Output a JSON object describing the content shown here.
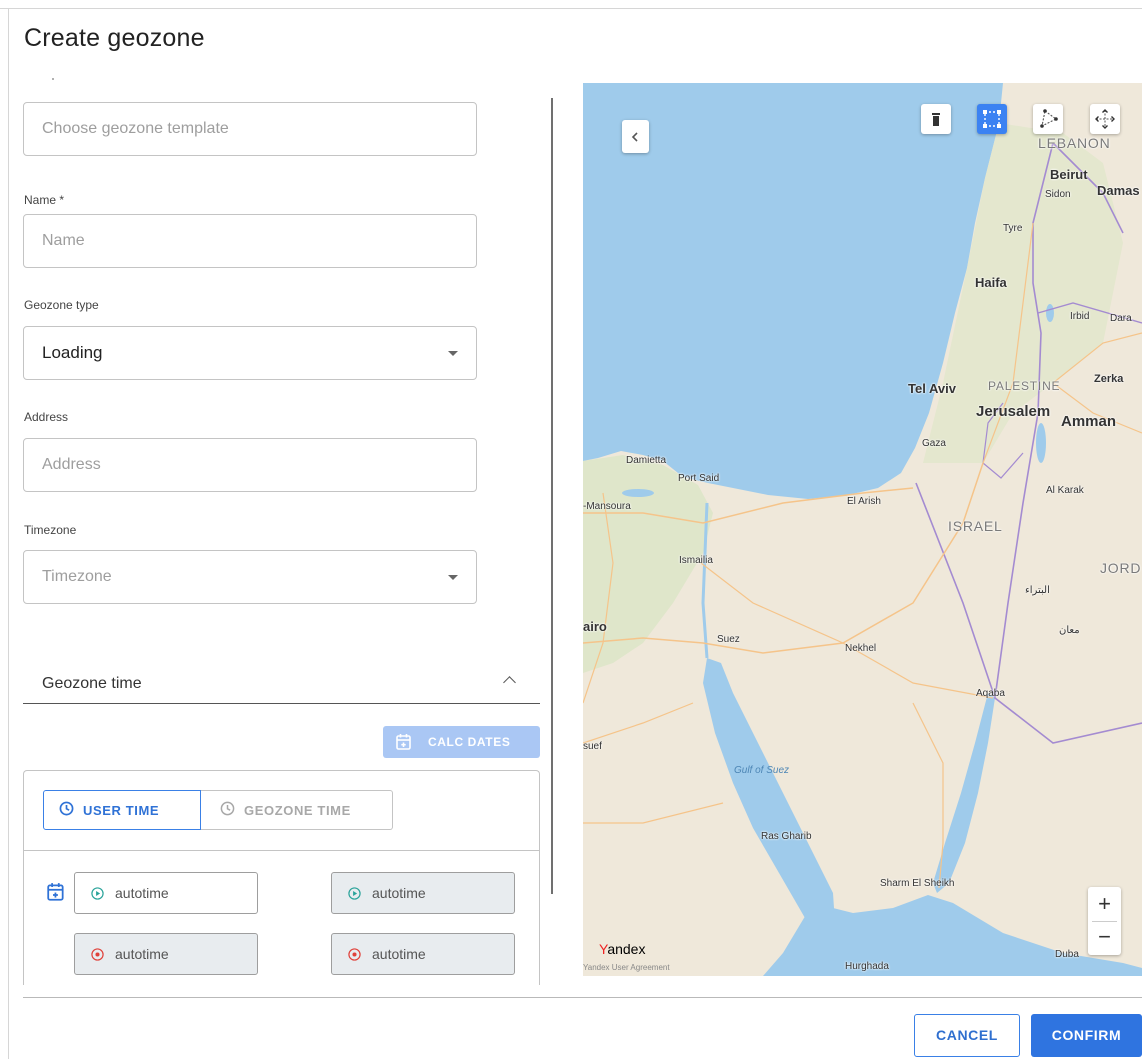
{
  "dialog": {
    "title": "Create geozone"
  },
  "form": {
    "template": {
      "placeholder": "Choose geozone template"
    },
    "name": {
      "label": "Name *",
      "placeholder": "Name"
    },
    "geozone_type": {
      "label": "Geozone type",
      "value": "Loading"
    },
    "address": {
      "label": "Address",
      "placeholder": "Address"
    },
    "timezone": {
      "label": "Timezone",
      "placeholder": "Timezone"
    }
  },
  "geozone_time": {
    "title": "Geozone time",
    "calc_dates_label": "CALC DATES",
    "tabs": [
      {
        "label": "USER TIME",
        "selected": true
      },
      {
        "label": "GEOZONE TIME",
        "selected": false
      }
    ],
    "rows": [
      {
        "start": "autotime",
        "end": "autotime"
      },
      {
        "start": "autotime",
        "end": "autotime"
      }
    ]
  },
  "map": {
    "tools": [
      "trash-icon",
      "rectangle-select-icon",
      "polygon-icon",
      "move-icon"
    ],
    "active_tool": "rectangle-select-icon",
    "zoom_in": "+",
    "zoom_out": "−",
    "provider": "Yandex",
    "attribution": "Yandex User Agreement",
    "labels": {
      "lebanon": "LEBANON",
      "beirut": "Beirut",
      "damascus": "Damas",
      "sidon": "Sidon",
      "tyre": "Tyre",
      "haifa": "Haifa",
      "irbid": "Irbid",
      "dara": "Dara",
      "tel_aviv": "Tel Aviv",
      "palestine": "PALESTINE",
      "zerka": "Zerka",
      "jerusalem": "Jerusalem",
      "amman": "Amman",
      "gaza": "Gaza",
      "damietta": "Damietta",
      "port_said": "Port Said",
      "mansoura": "-Mansoura",
      "el_arish": "El Arish",
      "al_karak": "Al Karak",
      "israel": "ISRAEL",
      "ismailia": "Ismailia",
      "jordan": "JORD",
      "cairo": "airo",
      "suez": "Suez",
      "nekhel": "Nekhel",
      "aqaba": "Aqaba",
      "suef": "suef",
      "gulf_of_suez": "Gulf of Suez",
      "ras_gharib": "Ras Gharib",
      "sharm": "Sharm El Sheikh",
      "hurghada": "Hurghada",
      "duba": "Duba",
      "arabic1": "البتراء",
      "arabic2": "معان"
    }
  },
  "footer": {
    "cancel": "CANCEL",
    "confirm": "CONFIRM"
  },
  "colors": {
    "accent": "#2f74e0",
    "accent_light": "#aac7f4",
    "sea": "#9fcbeb",
    "land": "#efe8da"
  }
}
